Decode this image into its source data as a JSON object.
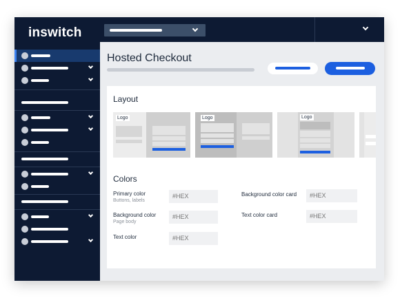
{
  "app": {
    "brand": "inswitch"
  },
  "main": {
    "title": "Hosted Checkout"
  },
  "layout_section": {
    "title": "Layout",
    "thumbnails": [
      {
        "logo": "Logo"
      },
      {
        "logo": "Logo"
      },
      {
        "logo": "Logo"
      },
      {
        "logo": ""
      }
    ]
  },
  "colors_section": {
    "title": "Colors",
    "fields": {
      "primary": {
        "label": "Primary color",
        "help": "Buttons, labels",
        "placeholder": "#HEX"
      },
      "background": {
        "label": "Background color",
        "help": "Page body",
        "placeholder": "#HEX"
      },
      "text": {
        "label": "Text color",
        "placeholder": "#HEX"
      },
      "background_card": {
        "label": "Background color card",
        "placeholder": "#HEX"
      },
      "text_card": {
        "label": "Text color card",
        "placeholder": "#HEX"
      }
    }
  },
  "colors": {
    "sidebar_bg": "#0d1a33",
    "accent": "#1c5fe0",
    "active_item": "#183a6e"
  }
}
